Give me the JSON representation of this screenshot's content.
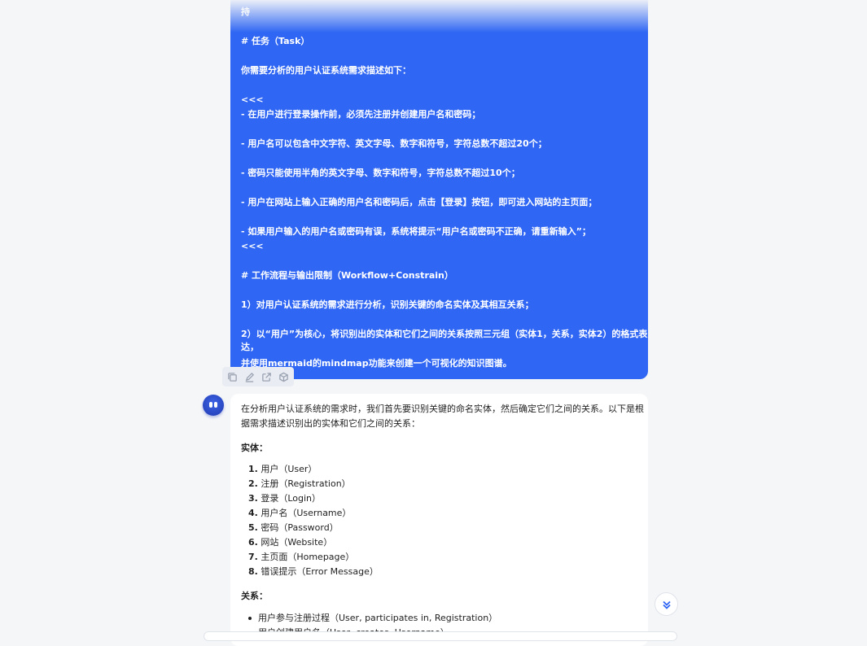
{
  "user_message": {
    "lines": [
      "持",
      "# 任务（Task）",
      "你需要分析的用户认证系统需求描述如下：",
      "<<<",
      "- 在用户进行登录操作前，必须先注册并创建用户名和密码；",
      "- 用户名可以包含中文字符、英文字母、数字和符号，字符总数不超过20个；",
      "- 密码只能使用半角的英文字母、数字和符号，字符总数不超过10个；",
      "- 用户在网站上输入正确的用户名和密码后，点击【登录】按钮，即可进入网站的主页面；",
      "- 如果用户输入的用户名或密码有误，系统将提示“用户名或密码不正确，请重新输入”；",
      "<<<",
      "# 工作流程与输出限制（Workflow+Constrain）",
      "1）对用户认证系统的需求进行分析，识别关键的命名实体及其相互关系；",
      "2）以“用户”为核心，将识别出的实体和它们之间的关系按照三元组（实体1，关系，实体2）的格式表",
      "达，",
      "并使用mermaid的mindmap功能来创建一个可视化的知识图谱。"
    ]
  },
  "actions": {
    "icons": [
      "copy-icon",
      "edit-icon",
      "share-icon",
      "cube-icon"
    ]
  },
  "assistant_message": {
    "intro_line1": "在分析用户认证系统的需求时，我们首先要识别关键的命名实体，然后确定它们之间的关系。以下是根",
    "intro_line2": "据需求描述识别出的实体和它们之间的关系：",
    "entities_heading": "实体：",
    "entities": [
      {
        "num": "1.",
        "text": "用户（User）"
      },
      {
        "num": "2.",
        "text": "注册（Registration）"
      },
      {
        "num": "3.",
        "text": "登录（Login）"
      },
      {
        "num": "4.",
        "text": "用户名（Username）"
      },
      {
        "num": "5.",
        "text": "密码（Password）"
      },
      {
        "num": "6.",
        "text": "网站（Website）"
      },
      {
        "num": "7.",
        "text": "主页面（Homepage）"
      },
      {
        "num": "8.",
        "text": "错误提示（Error Message）"
      }
    ],
    "relations_heading": "关系：",
    "relations": [
      "用户参与注册过程（User, participates in, Registration）",
      "用户创建用户名（User, creates, Username）"
    ]
  },
  "colors": {
    "user_bubble": "#2f66f3",
    "background": "#f5f6f8",
    "accent": "#2f66f3"
  }
}
